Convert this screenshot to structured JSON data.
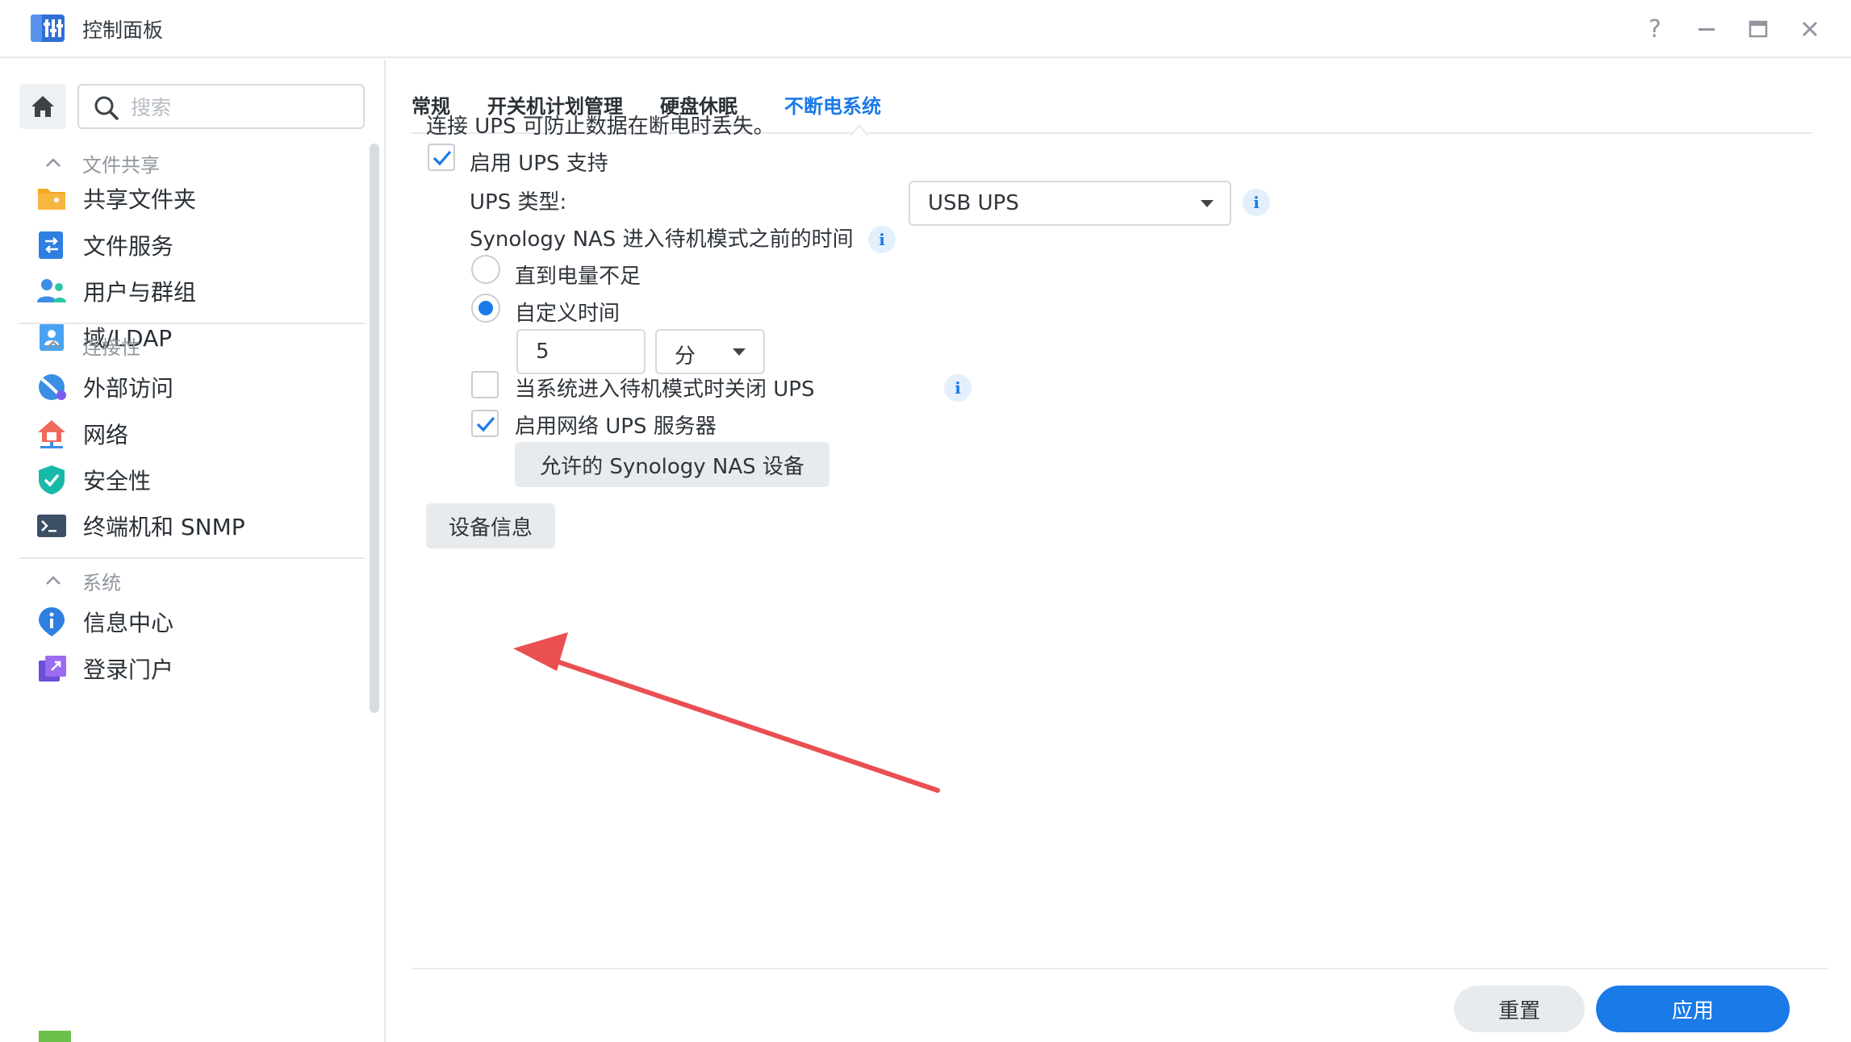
{
  "window": {
    "title": "控制面板"
  },
  "sidebar": {
    "search_placeholder": "搜索",
    "sections": [
      {
        "label": "文件共享",
        "items": [
          "共享文件夹",
          "文件服务",
          "用户与群组",
          "域/LDAP"
        ]
      },
      {
        "label": "连接性",
        "items": [
          "外部访问",
          "网络",
          "安全性",
          "终端机和 SNMP"
        ]
      },
      {
        "label": "系统",
        "items": [
          "信息中心",
          "登录门户"
        ]
      }
    ]
  },
  "tabs": [
    "常规",
    "开关机计划管理",
    "硬盘休眠",
    "不断电系统"
  ],
  "active_tab": "不断电系统",
  "ups": {
    "description": "连接 UPS 可防止数据在断电时丢失。",
    "enable_label": "启用 UPS 支持",
    "enable_checked": true,
    "type_label": "UPS 类型:",
    "type_value": "USB UPS",
    "standby_time_label": "Synology NAS 进入待机模式之前的时间",
    "option_low_battery": "直到电量不足",
    "option_custom_time": "自定义时间",
    "selected_option": "自定义时间",
    "time_value": "5",
    "time_unit": "分",
    "shutdown_ups_label": "当系统进入待机模式时关闭 UPS",
    "shutdown_ups_checked": false,
    "network_server_label": "启用网络 UPS 服务器",
    "network_server_checked": true,
    "allowed_devices_button": "允许的 Synology NAS 设备",
    "device_info_button": "设备信息"
  },
  "footer": {
    "reset_label": "重置",
    "apply_label": "应用"
  },
  "colors": {
    "accent": "#1a7ae8",
    "annotation_arrow": "#ea4f52"
  }
}
